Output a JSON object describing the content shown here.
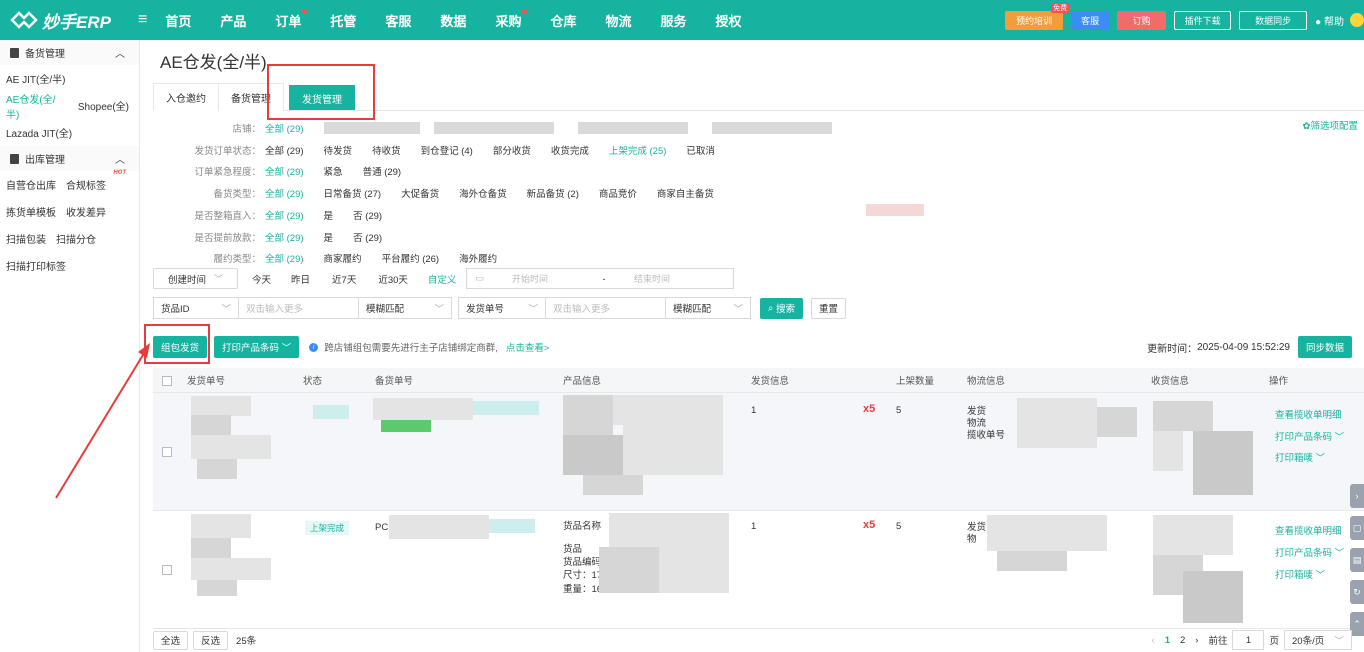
{
  "app": {
    "logo_text": "妙手ERP"
  },
  "topnav": {
    "items": [
      "首页",
      "产品",
      "订单",
      "托管",
      "客服",
      "数据",
      "采购",
      "仓库",
      "物流",
      "服务",
      "授权"
    ],
    "right": {
      "training": "预约培训",
      "free_badge": "免费",
      "service": "客服",
      "subscribe": "订购",
      "plugin": "插件下载",
      "sync": "数据同步",
      "help": "帮助"
    }
  },
  "sidebar": {
    "group1": "备货管理",
    "group1_items": [
      "AE JIT(全/半)",
      "AE仓发(全/半)",
      "Shopee(全)",
      "Lazada JIT(全)"
    ],
    "group2": "出库管理",
    "group2_items": [
      "自营仓出库",
      "合规标签",
      "拣货单模板",
      "收发差异",
      "扫描包装",
      "扫描分仓",
      "扫描打印标签"
    ],
    "hot_badge": "HOT"
  },
  "page": {
    "title": "AE仓发(全/半)"
  },
  "tabs": [
    "入仓邀约",
    "备货管理",
    "发货管理"
  ],
  "filters": {
    "config": "筛选项配置",
    "store": {
      "label": "店铺：",
      "all": "全部 (29)"
    },
    "status": {
      "label": "发货订单状态：",
      "options": [
        "全部 (29)",
        "待发货",
        "待收货",
        "到仓登记 (4)",
        "部分收货",
        "收货完成",
        "上架完成 (25)",
        "已取消"
      ]
    },
    "urgency": {
      "label": "订单紧急程度：",
      "options": [
        "全部 (29)",
        "紧急",
        "普通 (29)"
      ]
    },
    "stock_type": {
      "label": "备货类型：",
      "options": [
        "全部 (29)",
        "日常备货 (27)",
        "大促备货",
        "海外仓备货",
        "新品备货 (2)",
        "商品竞价",
        "商家自主备货"
      ]
    },
    "box": {
      "label": "是否整箱直入：",
      "options": [
        "全部 (29)",
        "是",
        "否 (29)"
      ]
    },
    "early": {
      "label": "是否提前放款：",
      "options": [
        "全部 (29)",
        "是",
        "否 (29)"
      ]
    },
    "fulfill": {
      "label": "履约类型：",
      "options": [
        "全部 (29)",
        "商家履约",
        "平台履约 (26)",
        "海外履约"
      ]
    }
  },
  "date": {
    "select": "创建时间",
    "options": [
      "今天",
      "昨日",
      "近7天",
      "近30天",
      "自定义"
    ],
    "start": "开始时间",
    "sep": "-",
    "end": "结束时间"
  },
  "search": {
    "field1": "货品ID",
    "ph1": "双击输入更多",
    "match1": "模糊匹配",
    "field2": "发货单号",
    "ph2": "双击输入更多",
    "match2": "模糊匹配",
    "search_btn": "搜索",
    "reset_btn": "重置"
  },
  "actions": {
    "bundle": "组包发货",
    "print": "打印产品条码",
    "tip": "跨店铺组包需要先进行主子店铺绑定商群,",
    "tip_link": "点击查看>",
    "update_label": "更新时间：",
    "update_time": "2025-04-09 15:52:29",
    "sync_btn": "同步数据"
  },
  "table": {
    "headers": [
      "发货单号",
      "状态",
      "备货单号",
      "产品信息",
      "发货信息",
      "上架数量",
      "物流信息",
      "收货信息",
      "操作"
    ],
    "rows": [
      {
        "ship_qty": "1",
        "mult": "x5",
        "shelf": "5",
        "logi1": "发货",
        "logi2": "物流",
        "logi3": "揽收单号",
        "ops": [
          "查看揽收单明细",
          "打印产品条码",
          "打印箱唛"
        ]
      },
      {
        "status": "上架完成",
        "stock_prefix": "PC",
        "ship_qty": "1",
        "mult": "x5",
        "shelf": "5",
        "prod_name": "货品名称",
        "prod_l2": "货品",
        "prod_l3": "货品编码",
        "prod_l4": "尺寸：17",
        "prod_l5": "重量：16",
        "logi1": "发货",
        "logi2": "物",
        "ops": [
          "查看揽收单明细",
          "打印产品条码",
          "打印箱唛"
        ]
      }
    ]
  },
  "footer": {
    "select_all": "全选",
    "invert": "反选",
    "count": "25条",
    "pages": [
      "1",
      "2"
    ],
    "goto": "前往",
    "page_input": "1",
    "page_unit": "页",
    "page_size": "20条/页"
  }
}
